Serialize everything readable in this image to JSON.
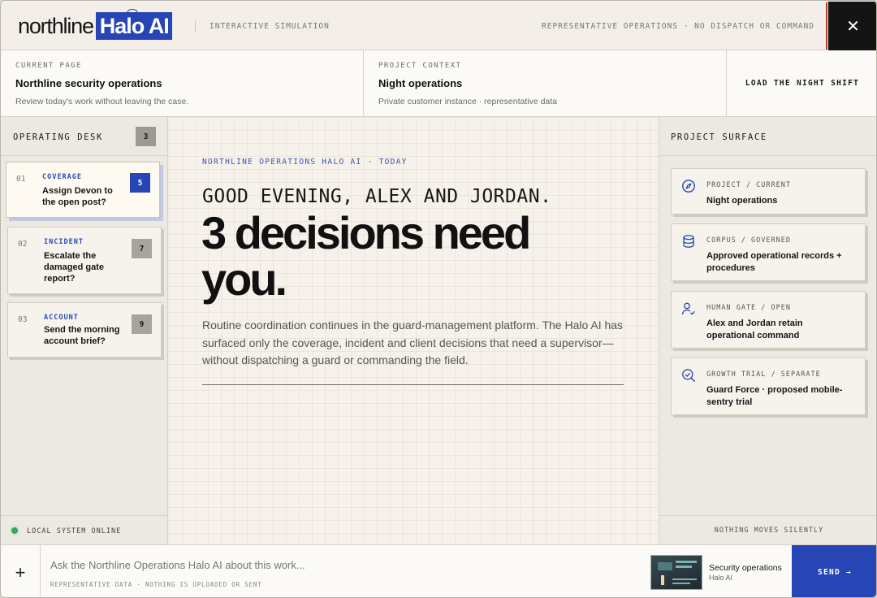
{
  "header": {
    "logo_word": "northline",
    "logo_badge": "Halo AI",
    "sim_label": "INTERACTIVE SIMULATION",
    "rep_label": "REPRESENTATIVE OPERATIONS · NO DISPATCH OR COMMAND",
    "close_glyph": "✕"
  },
  "context": {
    "current_page": {
      "kicker": "CURRENT PAGE",
      "title": "Northline security operations",
      "subtitle": "Review today's work without leaving the case."
    },
    "project": {
      "kicker": "PROJECT CONTEXT",
      "title": "Night operations",
      "subtitle": "Private customer instance · representative data"
    },
    "load_button": "LOAD THE NIGHT SHIFT"
  },
  "desk": {
    "title": "OPERATING DESK",
    "count": "3",
    "tasks": [
      {
        "num": "01",
        "tag": "COVERAGE",
        "text": "Assign Devon to the open post?",
        "badge": "5",
        "active": true
      },
      {
        "num": "02",
        "tag": "INCIDENT",
        "text": "Escalate the damaged gate report?",
        "badge": "7",
        "active": false
      },
      {
        "num": "03",
        "tag": "ACCOUNT",
        "text": "Send the morning account brief?",
        "badge": "9",
        "active": false
      }
    ],
    "status": "LOCAL SYSTEM ONLINE"
  },
  "main": {
    "kicker": "NORTHLINE OPERATIONS HALO AI · TODAY",
    "greeting": "GOOD EVENING, ALEX AND JORDAN.",
    "headline": "3 decisions need you.",
    "intro": "Routine coordination continues in the guard-management platform. The Halo AI has surfaced only the coverage, incident and client decisions that need a supervisor—without dispatching a guard or commanding the field."
  },
  "surface": {
    "title": "PROJECT SURFACE",
    "cards": [
      {
        "icon": "compass-icon",
        "kicker": "PROJECT / CURRENT",
        "text": "Night operations"
      },
      {
        "icon": "database-icon",
        "kicker": "CORPUS / GOVERNED",
        "text": "Approved operational records + procedures"
      },
      {
        "icon": "user-gate-icon",
        "kicker": "HUMAN GATE / OPEN",
        "text": "Alex and Jordan retain operational command"
      },
      {
        "icon": "search-check-icon",
        "kicker": "GROWTH TRIAL / SEPARATE",
        "text": "Guard Force · proposed mobile-sentry trial"
      }
    ],
    "footer": "NOTHING MOVES SILENTLY"
  },
  "composer": {
    "plus": "+",
    "placeholder": "Ask the Northline Operations Halo AI about this work...",
    "note": "REPRESENTATIVE DATA · NOTHING IS UPLOADED OR SENT",
    "chip_title": "Security operations",
    "chip_sub": "Halo AI",
    "send": "SEND →"
  },
  "colors": {
    "accent": "#2745b5",
    "ink": "#111111",
    "paper": "#f6f2eb",
    "status_online": "#3aa55f",
    "rule_red": "#b3402a"
  }
}
